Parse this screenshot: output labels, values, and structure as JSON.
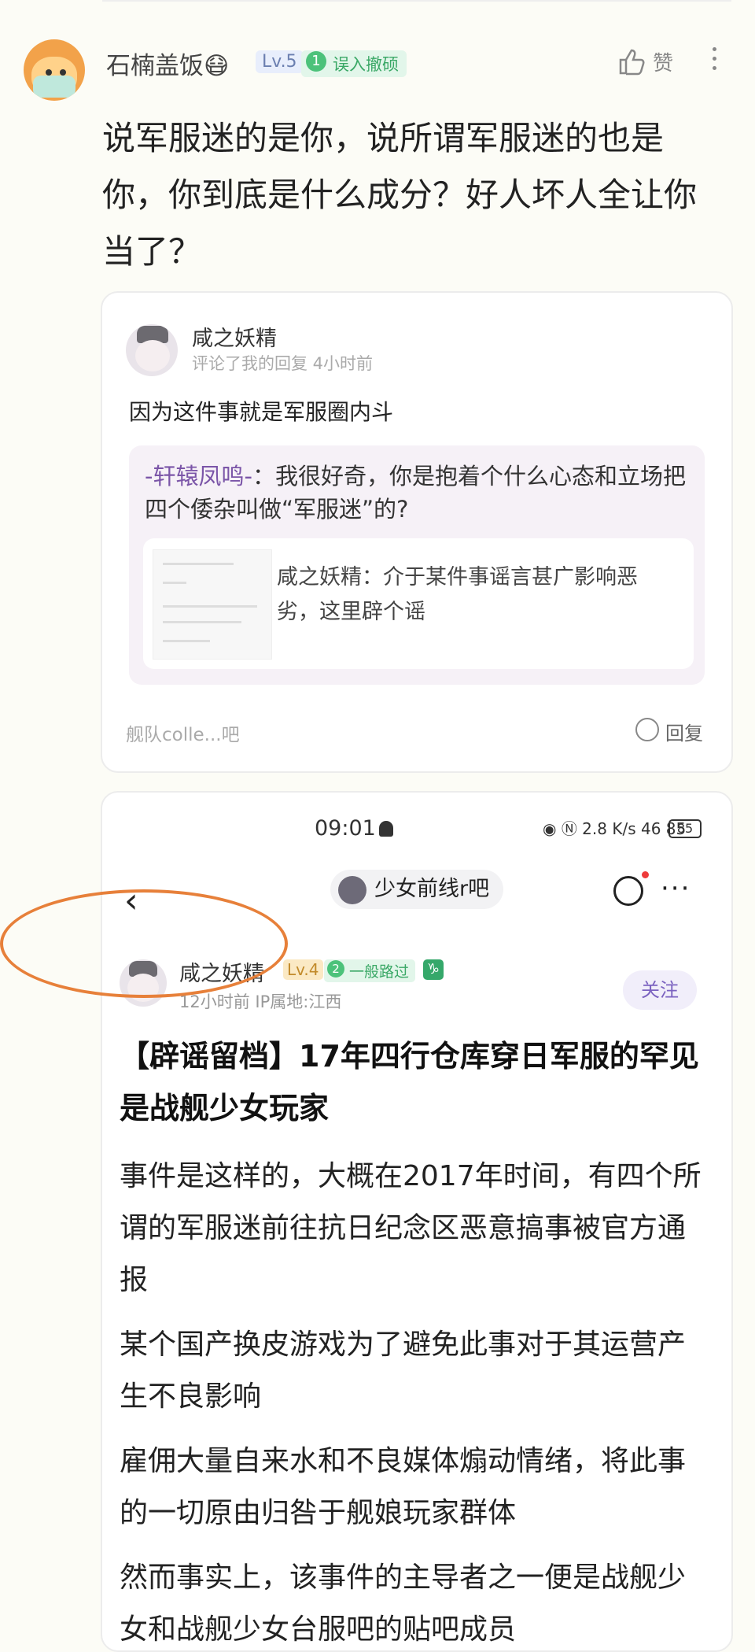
{
  "comment": {
    "username": "石楠盖饭😷",
    "level": "Lv.5",
    "medal_number": "1",
    "medal": "误入撤硕",
    "like_label": "赞",
    "text": "说军服迷的是你，说所谓军服迷的也是你，你到底是什么成分？好人坏人全让你当了？"
  },
  "reply_card": {
    "username": "咸之妖精",
    "meta": "评论了我的回复  4小时前",
    "text": "因为这件事就是军服圈内斗",
    "quote_author": "-轩辕凤鸣-",
    "quote_text": "：我很好奇，你是抱着个什么心态和立场把四个倭杂叫做“军服迷”的?",
    "inner_text": "咸之妖精：介于某件事谣言甚广影响恶劣，这里辟个谣",
    "footer": "舰队colle...吧",
    "reply_label": "回复"
  },
  "screenshot": {
    "status_bar": {
      "time": "09:01",
      "right": "2.8 K/s  46  85",
      "battery": "85"
    },
    "forum_name": "少女前线r吧",
    "author": "咸之妖精",
    "level": "Lv.4",
    "medal_number": "2",
    "medal": "一般路过",
    "zodiac": "♑",
    "meta": "12小时前    IP属地:江西",
    "follow_label": "关注",
    "title": "【辟谣留档】17年四行仓库穿日军服的罕见是战舰少女玩家",
    "paragraphs": [
      "事件是这样的，大概在2017年时间，有四个所谓的军服迷前往抗日纪念区恶意搞事被官方通报",
      "某个国产换皮游戏为了避免此事对于其运营产生不良影响",
      "雇佣大量自来水和不良媒体煽动情绪，将此事的一切原由归咎于舰娘玩家群体",
      "然而事实上，该事件的主导者之一便是战舰少女和战舰少女台服吧的贴吧成员"
    ]
  },
  "colors": {
    "accent_purple": "#7b55a8",
    "medal_green": "#3aa866",
    "circle_orange": "#e7803a"
  }
}
